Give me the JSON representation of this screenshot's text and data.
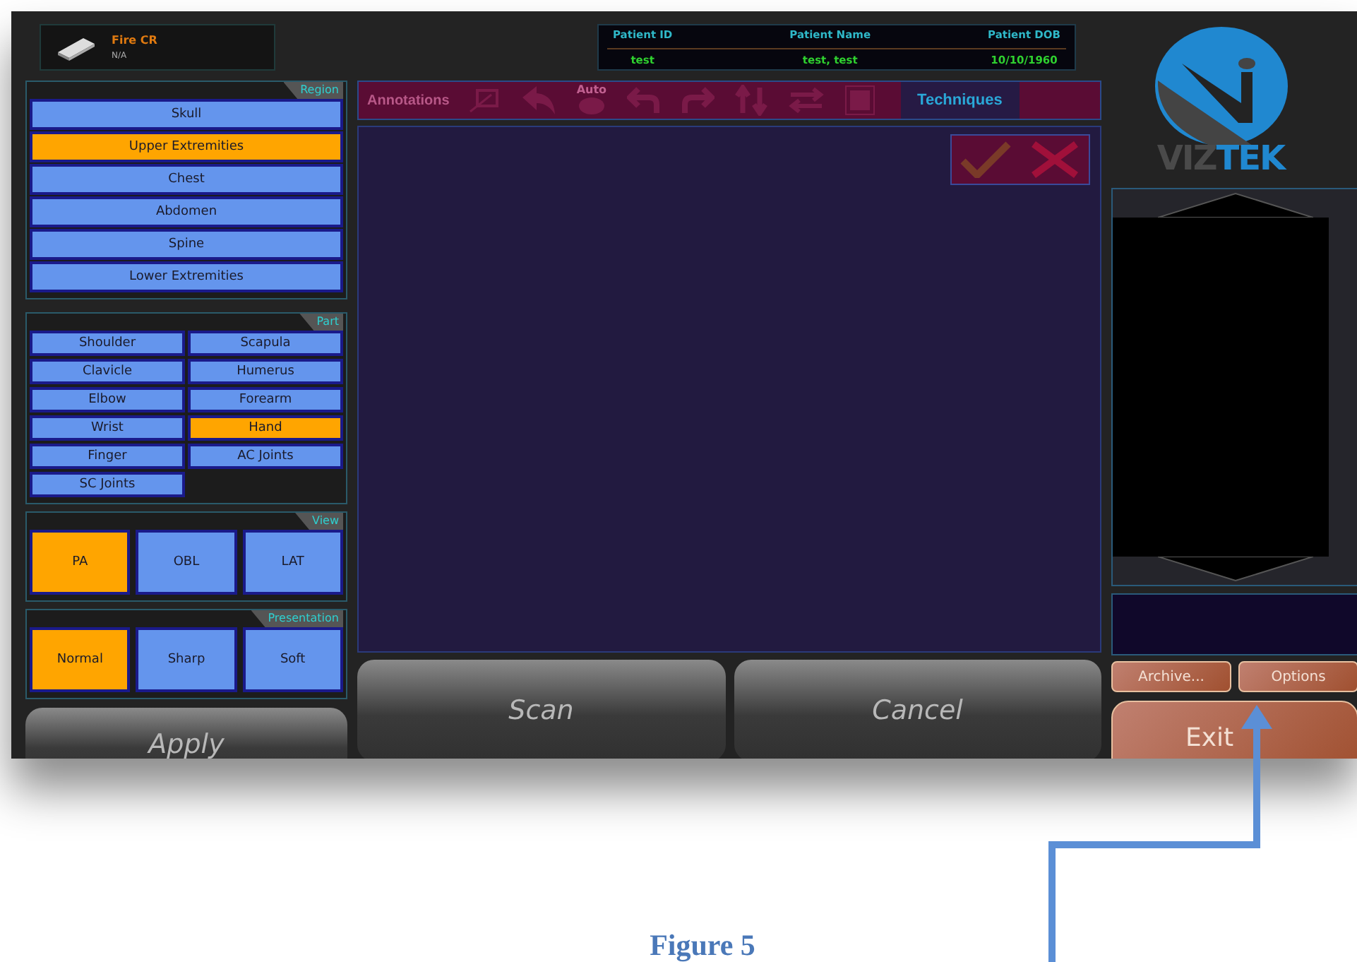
{
  "device": {
    "name": "Fire CR",
    "status": "N/A"
  },
  "patient": [
    {
      "label": "Patient ID",
      "value": "test"
    },
    {
      "label": "Patient Name",
      "value": "test, test"
    },
    {
      "label": "Patient DOB",
      "value": "10/10/1960"
    }
  ],
  "region": {
    "title": "Region",
    "items": [
      {
        "label": "Skull",
        "selected": false
      },
      {
        "label": "Upper Extremities",
        "selected": true
      },
      {
        "label": "Chest",
        "selected": false
      },
      {
        "label": "Abdomen",
        "selected": false
      },
      {
        "label": "Spine",
        "selected": false
      },
      {
        "label": "Lower Extremities",
        "selected": false
      }
    ]
  },
  "part": {
    "title": "Part",
    "items": [
      {
        "label": "Shoulder",
        "selected": false
      },
      {
        "label": "Scapula",
        "selected": false
      },
      {
        "label": "Clavicle",
        "selected": false
      },
      {
        "label": "Humerus",
        "selected": false
      },
      {
        "label": "Elbow",
        "selected": false
      },
      {
        "label": "Forearm",
        "selected": false
      },
      {
        "label": "Wrist",
        "selected": false
      },
      {
        "label": "Hand",
        "selected": true
      },
      {
        "label": "Finger",
        "selected": false
      },
      {
        "label": "AC Joints",
        "selected": false
      },
      {
        "label": "SC Joints",
        "selected": false
      }
    ]
  },
  "view": {
    "title": "View",
    "items": [
      {
        "label": "PA",
        "selected": true
      },
      {
        "label": "OBL",
        "selected": false
      },
      {
        "label": "LAT",
        "selected": false
      }
    ]
  },
  "presentation": {
    "title": "Presentation",
    "items": [
      {
        "label": "Normal",
        "selected": true
      },
      {
        "label": "Sharp",
        "selected": false
      },
      {
        "label": "Soft",
        "selected": false
      }
    ]
  },
  "toolbar": {
    "label": "Annotations",
    "auto_label": "Auto",
    "disabled": true,
    "tab": "Techniques"
  },
  "logo": [
    "VIZ",
    "TEK"
  ],
  "buttons": {
    "apply": "Apply",
    "scan": "Scan",
    "cancel": "Cancel",
    "archive": "Archive...",
    "options": "Options",
    "exit": "Exit"
  },
  "caption": "Figure 5"
}
